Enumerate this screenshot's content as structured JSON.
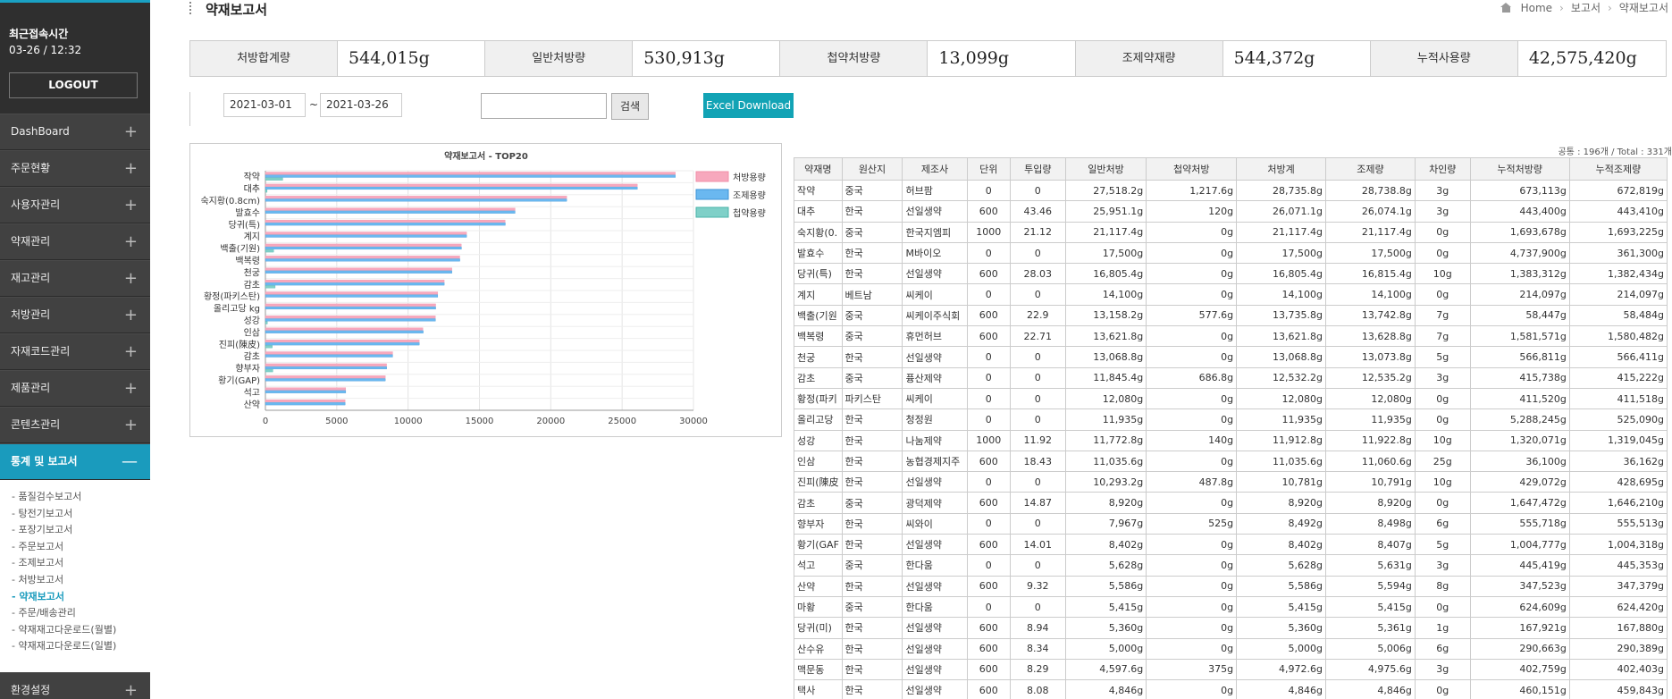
{
  "sidebar": {
    "login_title": "최근접속시간",
    "login_time": "03-26 / 12:32",
    "logout_label": "LOGOUT",
    "menu": [
      {
        "label": "DashBoard",
        "icon": "plus-icon"
      },
      {
        "label": "주문현황",
        "icon": "plus-icon"
      },
      {
        "label": "사용자관리",
        "icon": "plus-icon"
      },
      {
        "label": "약재관리",
        "icon": "plus-icon"
      },
      {
        "label": "재고관리",
        "icon": "plus-icon"
      },
      {
        "label": "처방관리",
        "icon": "plus-icon"
      },
      {
        "label": "자재코드관리",
        "icon": "plus-icon"
      },
      {
        "label": "제품관리",
        "icon": "plus-icon"
      },
      {
        "label": "콘텐츠관리",
        "icon": "plus-icon"
      }
    ],
    "active_menu": {
      "label": "통계 및 보고서",
      "icon": "minus-icon"
    },
    "submenu": [
      "- 품질검수보고서",
      "- 탕전기보고서",
      "- 포장기보고서",
      "- 주문보고서",
      "- 조제보고서",
      "- 처방보고서",
      "- 약재보고서",
      "- 주문/배송관리",
      "- 약재재고다운로드(월별)",
      "- 약재재고다운로드(일별)"
    ],
    "active_submenu_index": 6,
    "bottom_menu": {
      "label": "환경설정",
      "icon": "plus-icon"
    }
  },
  "header": {
    "title": "약재보고서",
    "breadcrumb": [
      "Home",
      "보고서",
      "약재보고서"
    ]
  },
  "summary": [
    {
      "label": "처방합계량",
      "value": "544,015g"
    },
    {
      "label": "일반처방량",
      "value": "530,913g"
    },
    {
      "label": "첩약처방량",
      "value": "13,099g"
    },
    {
      "label": "조제약재량",
      "value": "544,372g"
    },
    {
      "label": "누적사용량",
      "value": "42,575,420g"
    }
  ],
  "filter": {
    "date_from": "2021-03-01",
    "tilde": "~",
    "date_to": "2021-03-26",
    "search_value": "",
    "search_label": "검색",
    "excel_label": "Excel Download"
  },
  "table": {
    "count_text": "공통 : 196개 / Total : 331개",
    "columns": [
      "약재명",
      "원산지",
      "제조사",
      "단위",
      "투입량",
      "일반처방",
      "첩약처방",
      "처방계",
      "조제량",
      "차인량",
      "누적처방량",
      "누적조제량"
    ],
    "rows": [
      [
        "작약",
        "중국",
        "허브팜",
        "0",
        "0",
        "27,518.2g",
        "1,217.6g",
        "28,735.8g",
        "28,738.8g",
        "3g",
        "673,113g",
        "672,819g"
      ],
      [
        "대추",
        "한국",
        "선일생약",
        "600",
        "43.46",
        "25,951.1g",
        "120g",
        "26,071.1g",
        "26,074.1g",
        "3g",
        "443,400g",
        "443,410g"
      ],
      [
        "숙지황(0.",
        "중국",
        "한국지엠피",
        "1000",
        "21.12",
        "21,117.4g",
        "0g",
        "21,117.4g",
        "21,117.4g",
        "0g",
        "1,693,678g",
        "1,693,225g"
      ],
      [
        "발효수",
        "한국",
        "M바이오",
        "0",
        "0",
        "17,500g",
        "0g",
        "17,500g",
        "17,500g",
        "0g",
        "4,737,900g",
        "361,300g"
      ],
      [
        "당귀(특)",
        "한국",
        "선일생약",
        "600",
        "28.03",
        "16,805.4g",
        "0g",
        "16,805.4g",
        "16,815.4g",
        "10g",
        "1,383,312g",
        "1,382,434g"
      ],
      [
        "계지",
        "베트남",
        "씨케이",
        "0",
        "0",
        "14,100g",
        "0g",
        "14,100g",
        "14,100g",
        "0g",
        "214,097g",
        "214,097g"
      ],
      [
        "백출(기원",
        "중국",
        "씨케이주식회",
        "600",
        "22.9",
        "13,158.2g",
        "577.6g",
        "13,735.8g",
        "13,742.8g",
        "7g",
        "58,447g",
        "58,484g"
      ],
      [
        "백복령",
        "중국",
        "휴먼허브",
        "600",
        "22.71",
        "13,621.8g",
        "0g",
        "13,621.8g",
        "13,628.8g",
        "7g",
        "1,581,571g",
        "1,580,482g"
      ],
      [
        "천궁",
        "한국",
        "선일생약",
        "0",
        "0",
        "13,068.8g",
        "0g",
        "13,068.8g",
        "13,073.8g",
        "5g",
        "566,811g",
        "566,411g"
      ],
      [
        "감초",
        "중국",
        "퓽산제약",
        "0",
        "0",
        "11,845.4g",
        "686.8g",
        "12,532.2g",
        "12,535.2g",
        "3g",
        "415,738g",
        "415,222g"
      ],
      [
        "황정(파키",
        "파키스탄",
        "씨케이",
        "0",
        "0",
        "12,080g",
        "0g",
        "12,080g",
        "12,080g",
        "0g",
        "411,520g",
        "411,518g"
      ],
      [
        "올리고당",
        "한국",
        "청정원",
        "0",
        "0",
        "11,935g",
        "0g",
        "11,935g",
        "11,935g",
        "0g",
        "5,288,245g",
        "525,090g"
      ],
      [
        "성강",
        "한국",
        "나눔제약",
        "1000",
        "11.92",
        "11,772.8g",
        "140g",
        "11,912.8g",
        "11,922.8g",
        "10g",
        "1,320,071g",
        "1,319,045g"
      ],
      [
        "인삼",
        "한국",
        "농협경제지주",
        "600",
        "18.43",
        "11,035.6g",
        "0g",
        "11,035.6g",
        "11,060.6g",
        "25g",
        "36,100g",
        "36,162g"
      ],
      [
        "진피(陳皮",
        "한국",
        "선일생약",
        "0",
        "0",
        "10,293.2g",
        "487.8g",
        "10,781g",
        "10,791g",
        "10g",
        "429,072g",
        "428,695g"
      ],
      [
        "감초",
        "중국",
        "광덕제약",
        "600",
        "14.87",
        "8,920g",
        "0g",
        "8,920g",
        "8,920g",
        "0g",
        "1,647,472g",
        "1,646,210g"
      ],
      [
        "향부자",
        "한국",
        "씨와이",
        "0",
        "0",
        "7,967g",
        "525g",
        "8,492g",
        "8,498g",
        "6g",
        "555,718g",
        "555,513g"
      ],
      [
        "황기(GAF",
        "한국",
        "선일생약",
        "600",
        "14.01",
        "8,402g",
        "0g",
        "8,402g",
        "8,407g",
        "5g",
        "1,004,777g",
        "1,004,318g"
      ],
      [
        "석고",
        "중국",
        "한다움",
        "0",
        "0",
        "5,628g",
        "0g",
        "5,628g",
        "5,631g",
        "3g",
        "445,419g",
        "445,353g"
      ],
      [
        "산약",
        "한국",
        "선일생약",
        "600",
        "9.32",
        "5,586g",
        "0g",
        "5,586g",
        "5,594g",
        "8g",
        "347,523g",
        "347,379g"
      ],
      [
        "마황",
        "중국",
        "한다움",
        "0",
        "0",
        "5,415g",
        "0g",
        "5,415g",
        "5,415g",
        "0g",
        "624,609g",
        "624,420g"
      ],
      [
        "당귀(미)",
        "한국",
        "선일생약",
        "600",
        "8.94",
        "5,360g",
        "0g",
        "5,360g",
        "5,361g",
        "1g",
        "167,921g",
        "167,880g"
      ],
      [
        "산수유",
        "한국",
        "선일생약",
        "600",
        "8.34",
        "5,000g",
        "0g",
        "5,000g",
        "5,006g",
        "6g",
        "290,663g",
        "290,389g"
      ],
      [
        "맥문동",
        "한국",
        "선일생약",
        "600",
        "8.29",
        "4,597.6g",
        "375g",
        "4,972.6g",
        "4,975.6g",
        "3g",
        "402,759g",
        "402,403g"
      ],
      [
        "택사",
        "한국",
        "선일생약",
        "600",
        "8.08",
        "4,846g",
        "0g",
        "4,846g",
        "4,846g",
        "0g",
        "460,151g",
        "459,843g"
      ]
    ]
  },
  "chart_data": {
    "type": "bar",
    "orientation": "horizontal",
    "title": "약재보고서 - TOP20",
    "categories": [
      "작약",
      "대추",
      "숙지황(0.8cm)",
      "발효수",
      "당귀(특)",
      "계지",
      "백출(기원)",
      "백복령",
      "천궁",
      "감초",
      "황정(파키스탄)",
      "올리고당 kg",
      "성강",
      "인삼",
      "진피(陳皮)",
      "감초",
      "향부자",
      "황기(GAP)",
      "석고",
      "산약"
    ],
    "series": [
      {
        "name": "처방용량",
        "color": "#f7a8bd",
        "values": [
          28736,
          26071,
          21117,
          17500,
          16805,
          14100,
          13736,
          13622,
          13069,
          12532,
          12080,
          11935,
          11913,
          11036,
          10781,
          8920,
          8492,
          8402,
          5628,
          5586
        ]
      },
      {
        "name": "조제용량",
        "color": "#6ab8f0",
        "values": [
          28739,
          26074,
          21117,
          17500,
          16815,
          14100,
          13743,
          13629,
          13074,
          12535,
          12080,
          11935,
          11923,
          11061,
          10791,
          8920,
          8498,
          8407,
          5631,
          5594
        ]
      },
      {
        "name": "첩약용량",
        "color": "#7fd0c8",
        "values": [
          1218,
          120,
          0,
          0,
          0,
          0,
          578,
          0,
          0,
          687,
          0,
          0,
          140,
          0,
          488,
          0,
          525,
          0,
          0,
          0
        ]
      }
    ],
    "xticks": [
      "0",
      "5000",
      "10000",
      "15000",
      "20000",
      "25000",
      "30000"
    ],
    "xlim": [
      0,
      30000
    ],
    "grid": true,
    "legend": "right"
  }
}
